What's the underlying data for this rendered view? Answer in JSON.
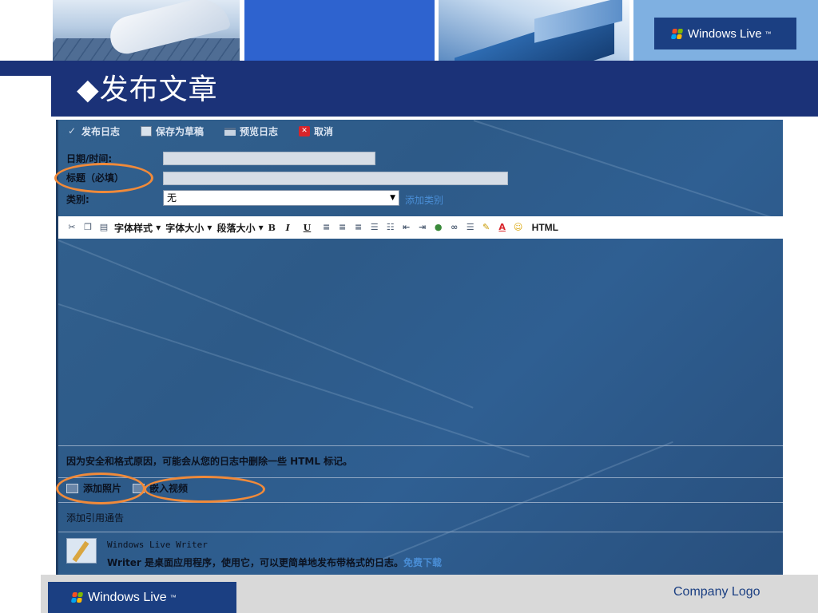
{
  "header": {
    "brand_top": "Windows Live",
    "trademark": "™"
  },
  "slide": {
    "title": "◆发布文章"
  },
  "toolbar": {
    "publish": "发布日志",
    "save_draft": "保存为草稿",
    "preview": "预览日志",
    "cancel": "取消"
  },
  "form": {
    "date_label": "日期/时间:",
    "title_label": "标题（必填）",
    "category_label": "类别:",
    "category_value": "无",
    "add_category": "添加类别"
  },
  "editor_toolbar": {
    "font_style": "字体样式",
    "font_size": "字体大小",
    "paragraph_size": "段落大小",
    "bold": "B",
    "italic": "I",
    "underline": "U",
    "html": "HTML"
  },
  "editor": {
    "note": "因为安全和格式原因，可能会从您的日志中删除一些 HTML 标记。",
    "add_photo": "添加照片",
    "embed_video": "嵌入视频",
    "trackback": "添加引用通告",
    "writer_title": "Windows Live Writer",
    "writer_desc": "Writer 是桌面应用程序，使用它，可以更简单地发布带格式的日志。",
    "free_download": "免费下载"
  },
  "footer": {
    "brand_bottom": "Windows Live",
    "company_logo": "Company Logo"
  },
  "colors": {
    "title_bar": "#1b3278",
    "screenshot_bg": "#2f5f92",
    "highlight": "#f08a3a",
    "link": "#4a8ed6"
  }
}
